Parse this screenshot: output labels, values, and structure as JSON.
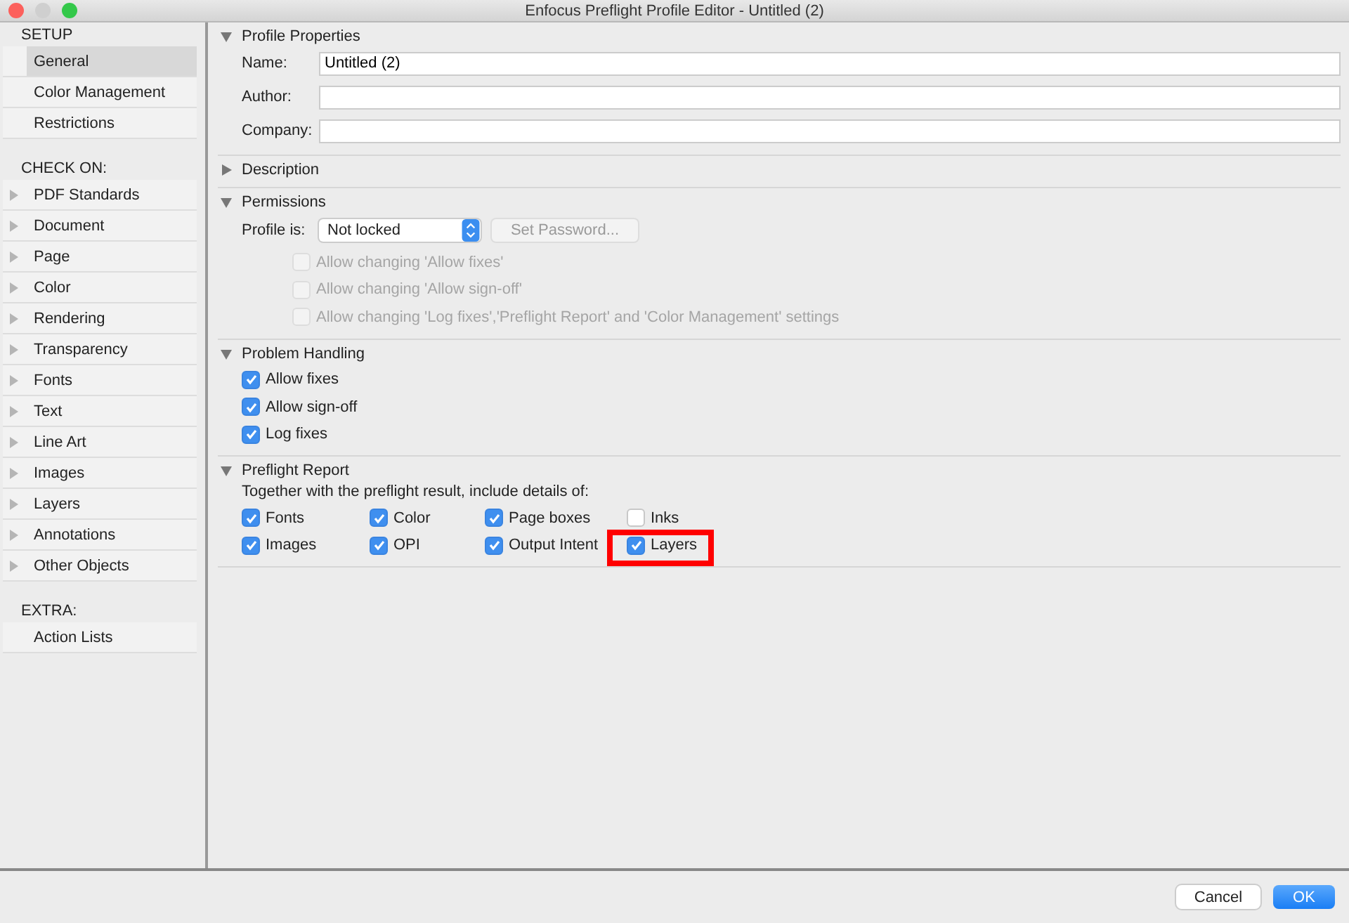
{
  "window": {
    "title": "Enfocus Preflight Profile Editor - Untitled (2)"
  },
  "sidebar": {
    "groups": [
      {
        "heading": "SETUP",
        "items": [
          {
            "label": "General",
            "selected": true,
            "kind": "plain"
          },
          {
            "label": "Color Management",
            "selected": false,
            "kind": "plain"
          },
          {
            "label": "Restrictions",
            "selected": false,
            "kind": "plain"
          }
        ]
      },
      {
        "heading": "CHECK ON:",
        "items": [
          {
            "label": "PDF Standards",
            "selected": false,
            "kind": "expandable"
          },
          {
            "label": "Document",
            "selected": false,
            "kind": "expandable"
          },
          {
            "label": "Page",
            "selected": false,
            "kind": "expandable"
          },
          {
            "label": "Color",
            "selected": false,
            "kind": "expandable"
          },
          {
            "label": "Rendering",
            "selected": false,
            "kind": "expandable"
          },
          {
            "label": "Transparency",
            "selected": false,
            "kind": "expandable"
          },
          {
            "label": "Fonts",
            "selected": false,
            "kind": "expandable"
          },
          {
            "label": "Text",
            "selected": false,
            "kind": "expandable"
          },
          {
            "label": "Line Art",
            "selected": false,
            "kind": "expandable"
          },
          {
            "label": "Images",
            "selected": false,
            "kind": "expandable"
          },
          {
            "label": "Layers",
            "selected": false,
            "kind": "expandable"
          },
          {
            "label": "Annotations",
            "selected": false,
            "kind": "expandable"
          },
          {
            "label": "Other Objects",
            "selected": false,
            "kind": "expandable"
          }
        ]
      },
      {
        "heading": "EXTRA:",
        "items": [
          {
            "label": "Action Lists",
            "selected": false,
            "kind": "plain"
          }
        ]
      }
    ]
  },
  "sections": [
    {
      "title": "Profile Properties",
      "expanded": true,
      "kind": "fields",
      "fields": [
        {
          "label": "Name:",
          "value": "Untitled (2)"
        },
        {
          "label": "Author:"
        },
        {
          "label": "Company:"
        }
      ]
    },
    {
      "title": "Description",
      "expanded": false
    },
    {
      "title": "Permissions",
      "expanded": true,
      "kind": "permissions",
      "profile_label": "Profile is:",
      "profile_value": "Not locked",
      "password_button": {
        "label": "Set Password...",
        "disabled": true
      },
      "options": [
        {
          "label": "Allow changing 'Allow fixes'",
          "checked": false,
          "disabled": true
        },
        {
          "label": "Allow changing 'Allow sign-off'",
          "checked": false,
          "disabled": true
        },
        {
          "label": "Allow changing 'Log fixes','Preflight Report' and 'Color Management' settings",
          "checked": false,
          "disabled": true
        }
      ]
    },
    {
      "title": "Problem Handling",
      "expanded": true,
      "kind": "checks",
      "options": [
        {
          "label": "Allow fixes",
          "checked": true
        },
        {
          "label": "Allow sign-off",
          "checked": true
        },
        {
          "label": "Log fixes",
          "checked": true
        }
      ]
    },
    {
      "title": "Preflight Report",
      "expanded": true,
      "kind": "grid",
      "intro": "Together with the preflight result, include details of:",
      "options": [
        {
          "label": "Fonts",
          "checked": true,
          "highlighted": false
        },
        {
          "label": "Color",
          "checked": true,
          "highlighted": false
        },
        {
          "label": "Page boxes",
          "checked": true,
          "highlighted": false
        },
        {
          "label": "Inks",
          "checked": false,
          "highlighted": false
        },
        {
          "label": "Images",
          "checked": true,
          "highlighted": false
        },
        {
          "label": "OPI",
          "checked": true,
          "highlighted": false
        },
        {
          "label": "Output Intent",
          "checked": true,
          "highlighted": false
        },
        {
          "label": "Layers",
          "checked": true,
          "highlighted": true
        }
      ]
    }
  ],
  "buttons": [
    {
      "label": "Cancel",
      "kind": "secondary"
    },
    {
      "label": "OK",
      "kind": "primary"
    }
  ]
}
